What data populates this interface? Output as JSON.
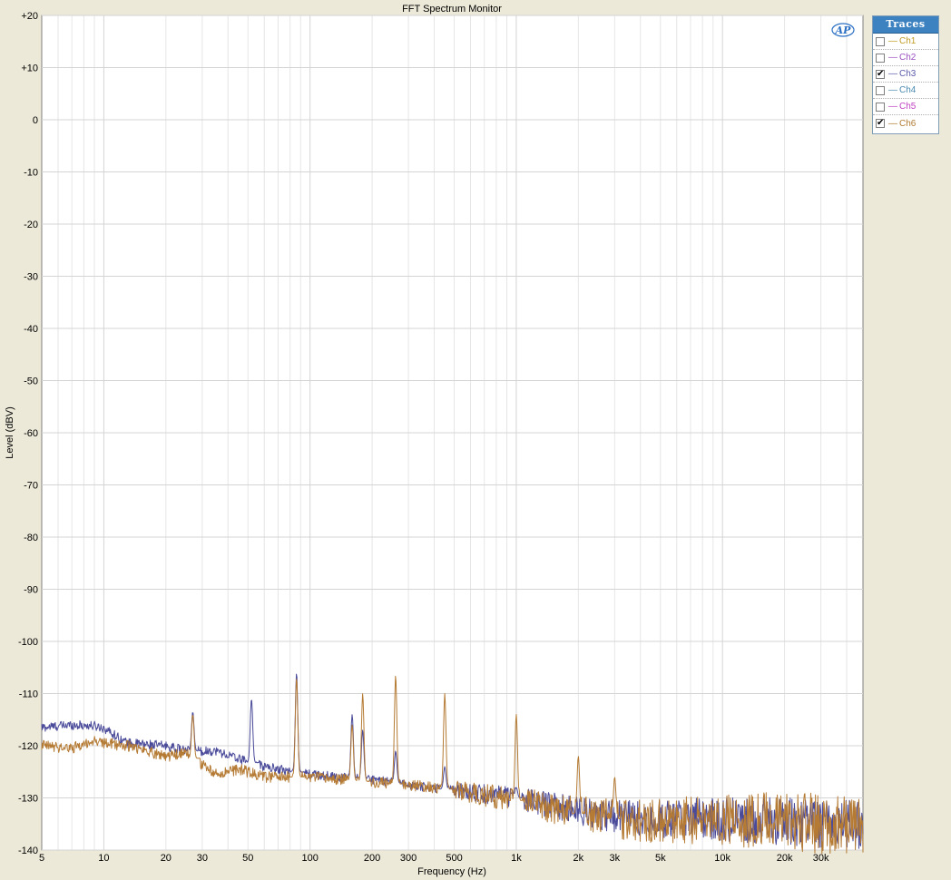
{
  "window": {
    "title": "FFT Spectrum Monitor"
  },
  "logo": {
    "text": "AP",
    "color": "#2a6fc4"
  },
  "traces_panel": {
    "header": "Traces",
    "items": [
      {
        "label": "Ch1",
        "checked": false,
        "color": "#c09a20"
      },
      {
        "label": "Ch2",
        "checked": false,
        "color": "#9a4fc0"
      },
      {
        "label": "Ch3",
        "checked": true,
        "color": "#5a5aa8"
      },
      {
        "label": "Ch4",
        "checked": false,
        "color": "#4a8ab0"
      },
      {
        "label": "Ch5",
        "checked": false,
        "color": "#c040c0"
      },
      {
        "label": "Ch6",
        "checked": true,
        "color": "#b07a30"
      }
    ]
  },
  "chart_data": {
    "type": "line",
    "title": "FFT Spectrum Monitor",
    "xlabel": "Frequency (Hz)",
    "ylabel": "Level (dBV)",
    "x_scale": "log",
    "xlim": [
      5,
      48000
    ],
    "ylim": [
      -140,
      20
    ],
    "grid": true,
    "y_ticks": [
      20,
      10,
      0,
      -10,
      -20,
      -30,
      -40,
      -50,
      -60,
      -70,
      -80,
      -90,
      -100,
      -110,
      -120,
      -130,
      -140
    ],
    "y_tick_labels": [
      "+20",
      "+10",
      "0",
      "-10",
      "-20",
      "-30",
      "-40",
      "-50",
      "-60",
      "-70",
      "-80",
      "-90",
      "-100",
      "-110",
      "-120",
      "-130",
      "-140"
    ],
    "x_ticks": [
      5,
      10,
      20,
      30,
      50,
      100,
      200,
      300,
      500,
      1000,
      2000,
      3000,
      5000,
      10000,
      20000,
      30000
    ],
    "x_tick_labels": [
      "5",
      "10",
      "20",
      "30",
      "50",
      "100",
      "200",
      "300",
      "500",
      "1k",
      "2k",
      "3k",
      "5k",
      "10k",
      "20k",
      "30k"
    ],
    "colors": {
      "plot_bg": "#ffffff",
      "grid": "#d4d4d4",
      "grid_minor": "#e6e6e6"
    },
    "series": [
      {
        "name": "Ch3",
        "color": "#4a4a9a",
        "baseline": [
          [
            5,
            -116.5
          ],
          [
            7,
            -116
          ],
          [
            9,
            -116.2
          ],
          [
            10,
            -116.6
          ],
          [
            13,
            -119.5
          ],
          [
            20,
            -120
          ],
          [
            25,
            -121
          ],
          [
            35,
            -121
          ],
          [
            45,
            -122.5
          ],
          [
            60,
            -124
          ],
          [
            100,
            -125.5
          ],
          [
            200,
            -126.5
          ],
          [
            300,
            -127.5
          ],
          [
            500,
            -128.5
          ],
          [
            1000,
            -130
          ],
          [
            2000,
            -132.5
          ],
          [
            3000,
            -133.5
          ],
          [
            5000,
            -134
          ],
          [
            10000,
            -134
          ],
          [
            20000,
            -134.5
          ],
          [
            30000,
            -135
          ],
          [
            48000,
            -135
          ]
        ],
        "peaks": [
          [
            27,
            -113.5
          ],
          [
            52,
            -111
          ],
          [
            86,
            -106
          ],
          [
            160,
            -114
          ],
          [
            180,
            -117
          ],
          [
            260,
            -121
          ],
          [
            450,
            -124
          ],
          [
            1000,
            -128
          ]
        ],
        "noise": 1.5
      },
      {
        "name": "Ch6",
        "color": "#b57b34",
        "baseline": [
          [
            5,
            -120
          ],
          [
            7,
            -120.5
          ],
          [
            9,
            -119
          ],
          [
            10,
            -119.5
          ],
          [
            13,
            -120
          ],
          [
            20,
            -122
          ],
          [
            25,
            -121.5
          ],
          [
            35,
            -125.5
          ],
          [
            45,
            -124.5
          ],
          [
            60,
            -126
          ],
          [
            100,
            -126
          ],
          [
            200,
            -127
          ],
          [
            300,
            -127.5
          ],
          [
            500,
            -128.5
          ],
          [
            1000,
            -130.5
          ],
          [
            2000,
            -133
          ],
          [
            3000,
            -134
          ],
          [
            5000,
            -134.5
          ],
          [
            10000,
            -134
          ],
          [
            20000,
            -134.5
          ],
          [
            30000,
            -135
          ],
          [
            48000,
            -135
          ]
        ],
        "peaks": [
          [
            27,
            -114
          ],
          [
            86,
            -107
          ],
          [
            160,
            -116
          ],
          [
            180,
            -110
          ],
          [
            260,
            -106.5
          ],
          [
            450,
            -110
          ],
          [
            1000,
            -114
          ],
          [
            2000,
            -122
          ],
          [
            3000,
            -126
          ]
        ],
        "noise": 1.8
      }
    ]
  }
}
